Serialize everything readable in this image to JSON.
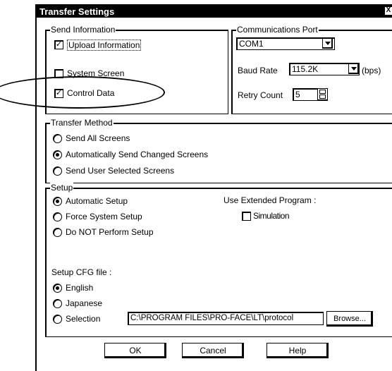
{
  "window": {
    "title": "Transfer Settings",
    "close_glyph": "X"
  },
  "send_information": {
    "title": "Send Information",
    "upload": {
      "label": "Upload Information",
      "checked": true
    },
    "system_screen": {
      "label": "System Screen",
      "checked": false
    },
    "control_data": {
      "label": "Control Data",
      "checked": true
    }
  },
  "communications_port": {
    "title": "Communications Port",
    "port_value": "COM1",
    "baud_label": "Baud Rate",
    "baud_value": "115.2K",
    "baud_unit": "(bps)",
    "retry_label": "Retry Count",
    "retry_value": "5"
  },
  "transfer_method": {
    "title": "Transfer Method",
    "options": [
      {
        "label": "Send All Screens",
        "selected": false
      },
      {
        "label": "Automatically Send Changed Screens",
        "selected": true
      },
      {
        "label": "Send User Selected Screens",
        "selected": false
      }
    ]
  },
  "setup": {
    "title": "Setup",
    "options": [
      {
        "label": "Automatic Setup",
        "selected": true
      },
      {
        "label": "Force System Setup",
        "selected": false
      },
      {
        "label": "Do NOT Perform Setup",
        "selected": false
      }
    ],
    "extended_label": "Use Extended Program :",
    "simulation": {
      "label": "Simulation",
      "checked": false
    },
    "cfg_label": "Setup CFG file :",
    "cfg_options": [
      {
        "label": "English",
        "selected": true
      },
      {
        "label": "Japanese",
        "selected": false
      },
      {
        "label": "Selection",
        "selected": false
      }
    ],
    "path_value": "C:\\PROGRAM FILES\\PRO-FACE\\LT\\protocol",
    "browse_label": "Browse..."
  },
  "buttons": {
    "ok": "OK",
    "cancel": "Cancel",
    "help": "Help"
  },
  "colors": {
    "background": "#ffffff",
    "foreground": "#000000",
    "titlebar": "#000000"
  }
}
